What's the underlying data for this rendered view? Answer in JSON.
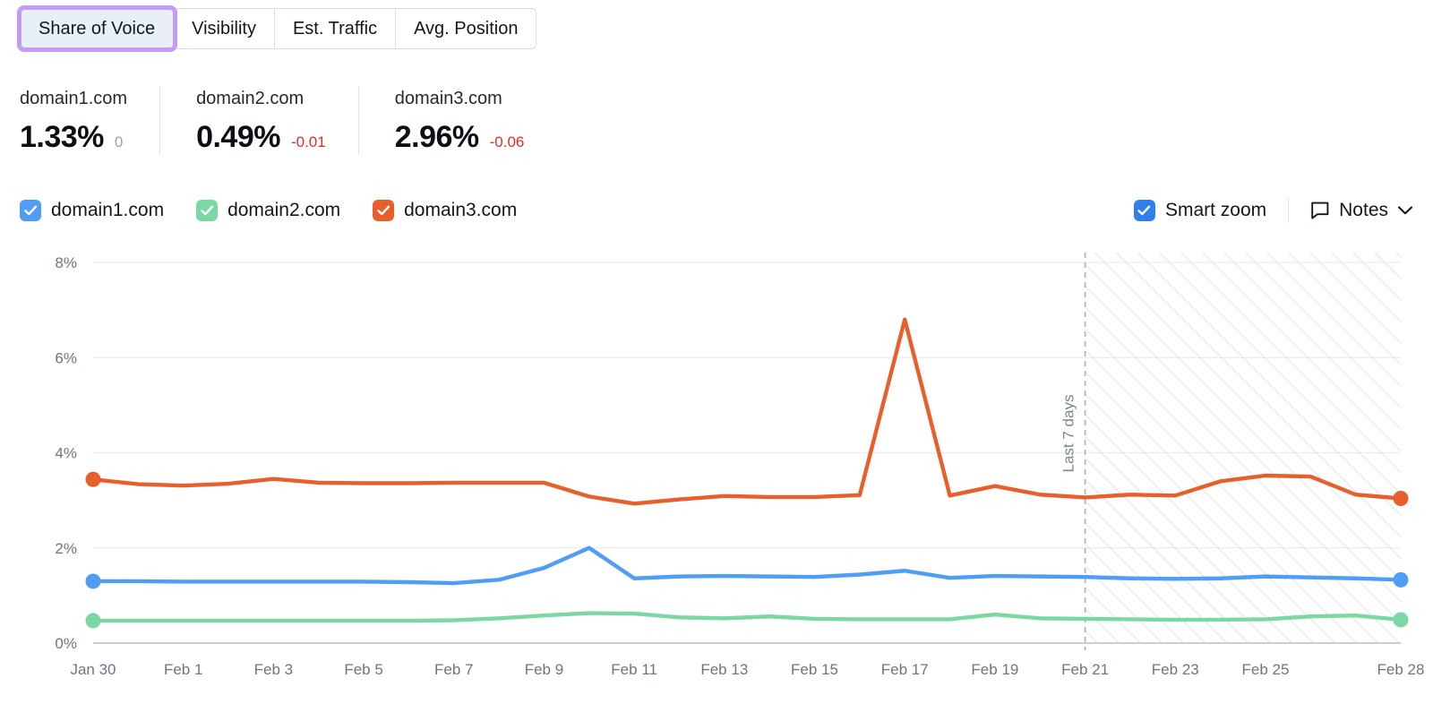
{
  "tabs": [
    {
      "label": "Share of Voice",
      "active": true
    },
    {
      "label": "Visibility",
      "active": false
    },
    {
      "label": "Est. Traffic",
      "active": false
    },
    {
      "label": "Avg. Position",
      "active": false
    }
  ],
  "metrics": [
    {
      "domain": "domain1.com",
      "value": "1.33%",
      "delta": "0",
      "delta_dir": "neutral"
    },
    {
      "domain": "domain2.com",
      "value": "0.49%",
      "delta": "-0.01",
      "delta_dir": "down"
    },
    {
      "domain": "domain3.com",
      "value": "2.96%",
      "delta": "-0.06",
      "delta_dir": "down"
    }
  ],
  "legend": [
    {
      "label": "domain1.com",
      "color": "#4f9df5",
      "checked": true
    },
    {
      "label": "domain2.com",
      "color": "#7bd8a4",
      "checked": true
    },
    {
      "label": "domain3.com",
      "color": "#e85f2c",
      "checked": true
    }
  ],
  "controls": {
    "smart_zoom_label": "Smart zoom",
    "smart_zoom_checked": true,
    "smart_zoom_color": "#2f80ed",
    "notes_label": "Notes",
    "notes_icon": "speech-bubble-icon",
    "chevron_icon": "chevron-down-icon"
  },
  "colors": {
    "accent_purple": "#c49bf7",
    "active_tab_bg": "#e9eff6",
    "delta_negative": "#e52b2b",
    "delta_neutral": "#9aa1ab",
    "grid": "#e9edf0",
    "axis": "#b9bfc6"
  },
  "chart_data": {
    "type": "line",
    "title": "",
    "xlabel": "",
    "ylabel": "",
    "ylim": [
      0,
      8
    ],
    "yticks": [
      "0%",
      "2%",
      "4%",
      "6%",
      "8%"
    ],
    "ytick_values": [
      0,
      2,
      4,
      6,
      8
    ],
    "grid": true,
    "legend_position": "top-left",
    "x": [
      "Jan 30",
      "Jan 31",
      "Feb 1",
      "Feb 2",
      "Feb 3",
      "Feb 4",
      "Feb 5",
      "Feb 6",
      "Feb 7",
      "Feb 8",
      "Feb 9",
      "Feb 10",
      "Feb 11",
      "Feb 12",
      "Feb 13",
      "Feb 14",
      "Feb 15",
      "Feb 16",
      "Feb 17",
      "Feb 18",
      "Feb 19",
      "Feb 20",
      "Feb 21",
      "Feb 22",
      "Feb 23",
      "Feb 24",
      "Feb 25",
      "Feb 26",
      "Feb 27",
      "Feb 28"
    ],
    "xtick_labels": [
      "Jan 30",
      "Feb 1",
      "Feb 3",
      "Feb 5",
      "Feb 7",
      "Feb 9",
      "Feb 11",
      "Feb 13",
      "Feb 15",
      "Feb 17",
      "Feb 19",
      "Feb 21",
      "Feb 23",
      "Feb 25",
      "Feb 28"
    ],
    "xtick_indices": [
      0,
      2,
      4,
      6,
      8,
      10,
      12,
      14,
      16,
      18,
      20,
      22,
      24,
      26,
      29
    ],
    "series": [
      {
        "name": "domain1.com",
        "color": "#4f9df5",
        "values": [
          1.3,
          1.3,
          1.29,
          1.29,
          1.29,
          1.29,
          1.29,
          1.28,
          1.26,
          1.33,
          1.58,
          2.0,
          1.36,
          1.4,
          1.41,
          1.4,
          1.39,
          1.44,
          1.52,
          1.37,
          1.41,
          1.4,
          1.39,
          1.36,
          1.35,
          1.36,
          1.4,
          1.38,
          1.36,
          1.33
        ]
      },
      {
        "name": "domain2.com",
        "color": "#7bd8a4",
        "values": [
          0.47,
          0.47,
          0.47,
          0.47,
          0.47,
          0.47,
          0.47,
          0.47,
          0.48,
          0.52,
          0.58,
          0.63,
          0.62,
          0.54,
          0.52,
          0.56,
          0.51,
          0.5,
          0.5,
          0.5,
          0.6,
          0.52,
          0.51,
          0.5,
          0.49,
          0.49,
          0.5,
          0.56,
          0.58,
          0.49
        ]
      },
      {
        "name": "domain3.com",
        "color": "#e85f2c",
        "values": [
          3.44,
          3.34,
          3.31,
          3.35,
          3.45,
          3.37,
          3.36,
          3.36,
          3.37,
          3.37,
          3.37,
          3.08,
          2.93,
          3.02,
          3.09,
          3.07,
          3.07,
          3.11,
          6.8,
          3.1,
          3.3,
          3.12,
          3.06,
          3.12,
          3.1,
          3.4,
          3.52,
          3.5,
          3.12,
          3.04
        ]
      }
    ],
    "annotations": [
      {
        "type": "shaded-region",
        "label": "Last 7 days",
        "start_index": 22,
        "end_index": 29,
        "style": "diagonal-hatch",
        "boundary": "dashed"
      }
    ]
  }
}
